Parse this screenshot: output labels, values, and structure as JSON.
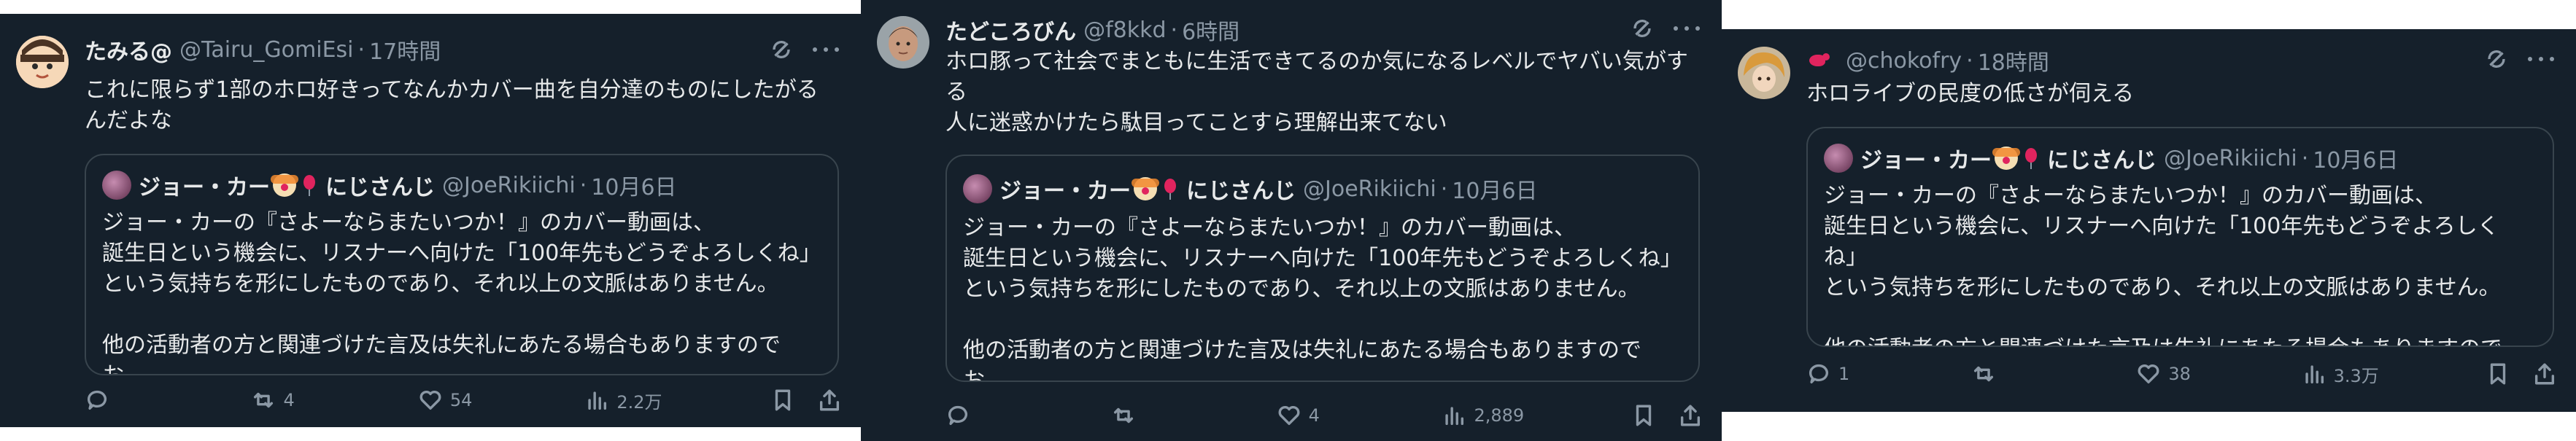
{
  "quote_post": {
    "display_name": "ジョー・カー",
    "org": "にじさんじ",
    "handle": "@JoeRikiichi",
    "time": "10月6日",
    "text": "ジョー・カーの『さよーならまたいつか！』のカバー動画は、\n誕生日という機会に、リスナーへ向けた「100年先もどうぞよろしくね」\nという気持ちを形にしたものであり、それ以上の文脈はありません。\n\n他の活動者の方と関連づけた言及は失礼にあたる場合もありますのでお..."
  },
  "tweets": [
    {
      "display_name": "たみる@",
      "handle": "@Tairu_GomiEsi",
      "separator": "·",
      "time": "17時間",
      "text": "これに限らず1部のホロ好きってなんかカバー曲を自分達のものにしたがる\nんだよな",
      "replies": "",
      "reposts": "4",
      "likes": "54",
      "views": "2.2万",
      "avatar_icon": "avatar-cartoon"
    },
    {
      "display_name": "たどころびん",
      "handle": "@f8kkd",
      "separator": "·",
      "time": "6時間",
      "text": "ホロ豚って社会でまともに生活できてるのか気になるレベルでヤバい気がす\nる\n人に迷惑かけたら駄目ってことすら理解出来てない",
      "replies": "",
      "reposts": "",
      "likes": "4",
      "views": "2,889",
      "avatar_icon": "avatar-photo"
    },
    {
      "display_name": "",
      "handle": "@chokofry",
      "separator": "·",
      "time": "18時間",
      "text": "ホロライブの民度の低さが伺える",
      "replies": "1",
      "reposts": "",
      "likes": "38",
      "views": "3.3万",
      "avatar_icon": "avatar-anime"
    }
  ],
  "icons": {
    "grok": "grok-icon",
    "more": "more-icon",
    "reply": "reply-icon",
    "repost": "repost-icon",
    "like": "like-icon",
    "views": "views-icon",
    "bookmark": "bookmark-icon",
    "share": "share-icon"
  },
  "colors": {
    "background": "#15202b",
    "text": "#e7e9ea",
    "muted": "#8b98a5",
    "border": "#38444d"
  }
}
